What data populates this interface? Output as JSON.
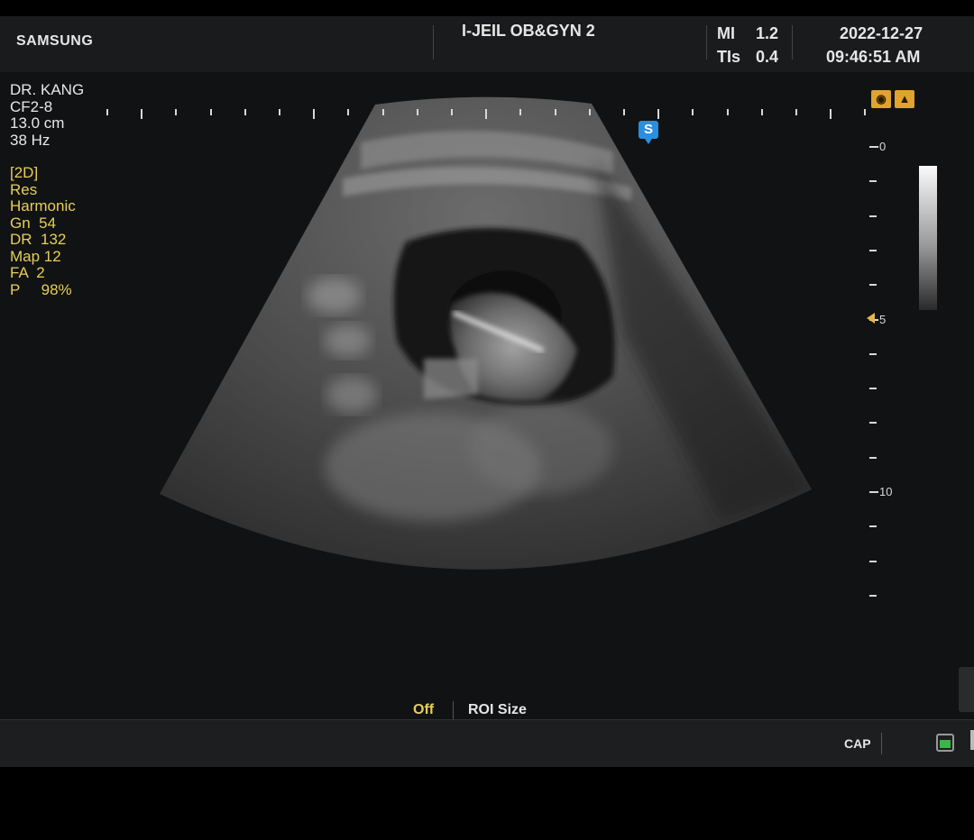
{
  "header": {
    "brand": "SAMSUNG",
    "hospital": "I-JEIL OB&GYN 2",
    "mi_label": "MI",
    "mi_value": "1.2",
    "tis_label": "TIs",
    "tis_value": "0.4",
    "date": "2022-12-27",
    "time": "09:46:51 AM"
  },
  "probe_info": {
    "operator": "DR. KANG",
    "probe": "CF2-8",
    "depth": "13.0 cm",
    "frame_rate": "38 Hz"
  },
  "imaging_params": {
    "mode": "[2D]",
    "res": "Res",
    "harmonic": "Harmonic",
    "gain": "Gn  54",
    "dynamic_range": "DR  132",
    "map": "Map 12",
    "fa": "FA  2",
    "power": "P     98%"
  },
  "depth_scale": {
    "labels": [
      "0",
      "5",
      "10"
    ],
    "unit": "cm"
  },
  "icons": {
    "orientation_left": "orientation-marker-icon",
    "orientation_right": "orientation-marker-icon",
    "s_marker": "s-marker-icon",
    "focus": "focus-arrow-icon",
    "battery": "battery-icon",
    "s_label": "S"
  },
  "bottom_bar": {
    "roi_status": "Off",
    "roi_label": "ROI Size",
    "cap_label": "CAP"
  },
  "colors": {
    "param_text": "#e6cf58",
    "white_text": "#e6e6e6",
    "s_marker": "#2b8fe0",
    "orientation": "#e2a22f",
    "battery": "#39b54a"
  }
}
